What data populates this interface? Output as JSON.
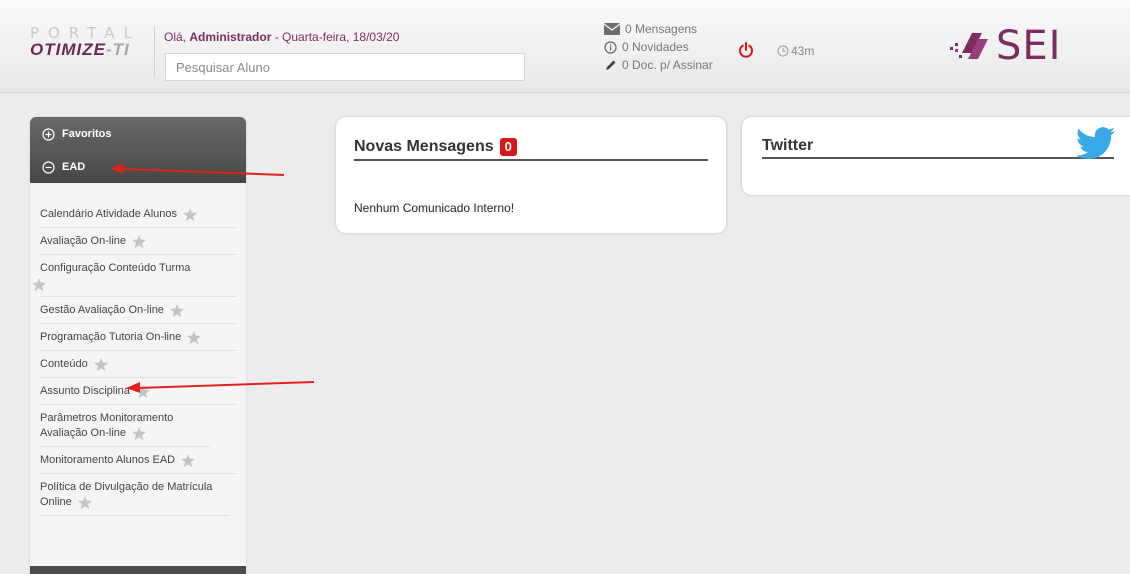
{
  "header": {
    "logo_top": "PORTAL",
    "logo_brand_a": "OTIMIZE",
    "logo_brand_b": "-TI",
    "greeting_prefix": "Olá,",
    "user_name": "Administrador",
    "date_text": "- Quarta-feira, 18/03/20",
    "search_placeholder": "Pesquisar Aluno",
    "messages": "0 Mensagens",
    "news": "0 Novidades",
    "docs": "0 Doc. p/ Assinar",
    "timer": "43m",
    "brand_sei": "SEI"
  },
  "sidebar": {
    "favoritos": "Favoritos",
    "ead": "EAD",
    "items": [
      "Calendário Atividade Alunos",
      "Avaliação On-line",
      "Configuração Conteúdo Turma",
      "Gestão Avaliação On-line",
      "Programação Tutoria On-line",
      "Conteúdo",
      "Assunto Disciplina",
      "Parâmetros Monitoramento Avaliação On-line",
      "Monitoramento Alunos EAD",
      "Política de Divulgação de Matrícula Online"
    ]
  },
  "panels": {
    "messages_title": "Novas Mensagens",
    "messages_count": "0",
    "messages_body": "Nenhum Comunicado Interno!",
    "twitter_title": "Twitter"
  },
  "colors": {
    "brand": "#7b2d63",
    "badge": "#d8161a",
    "power": "#d8161a",
    "twitter": "#3aa7e8"
  }
}
